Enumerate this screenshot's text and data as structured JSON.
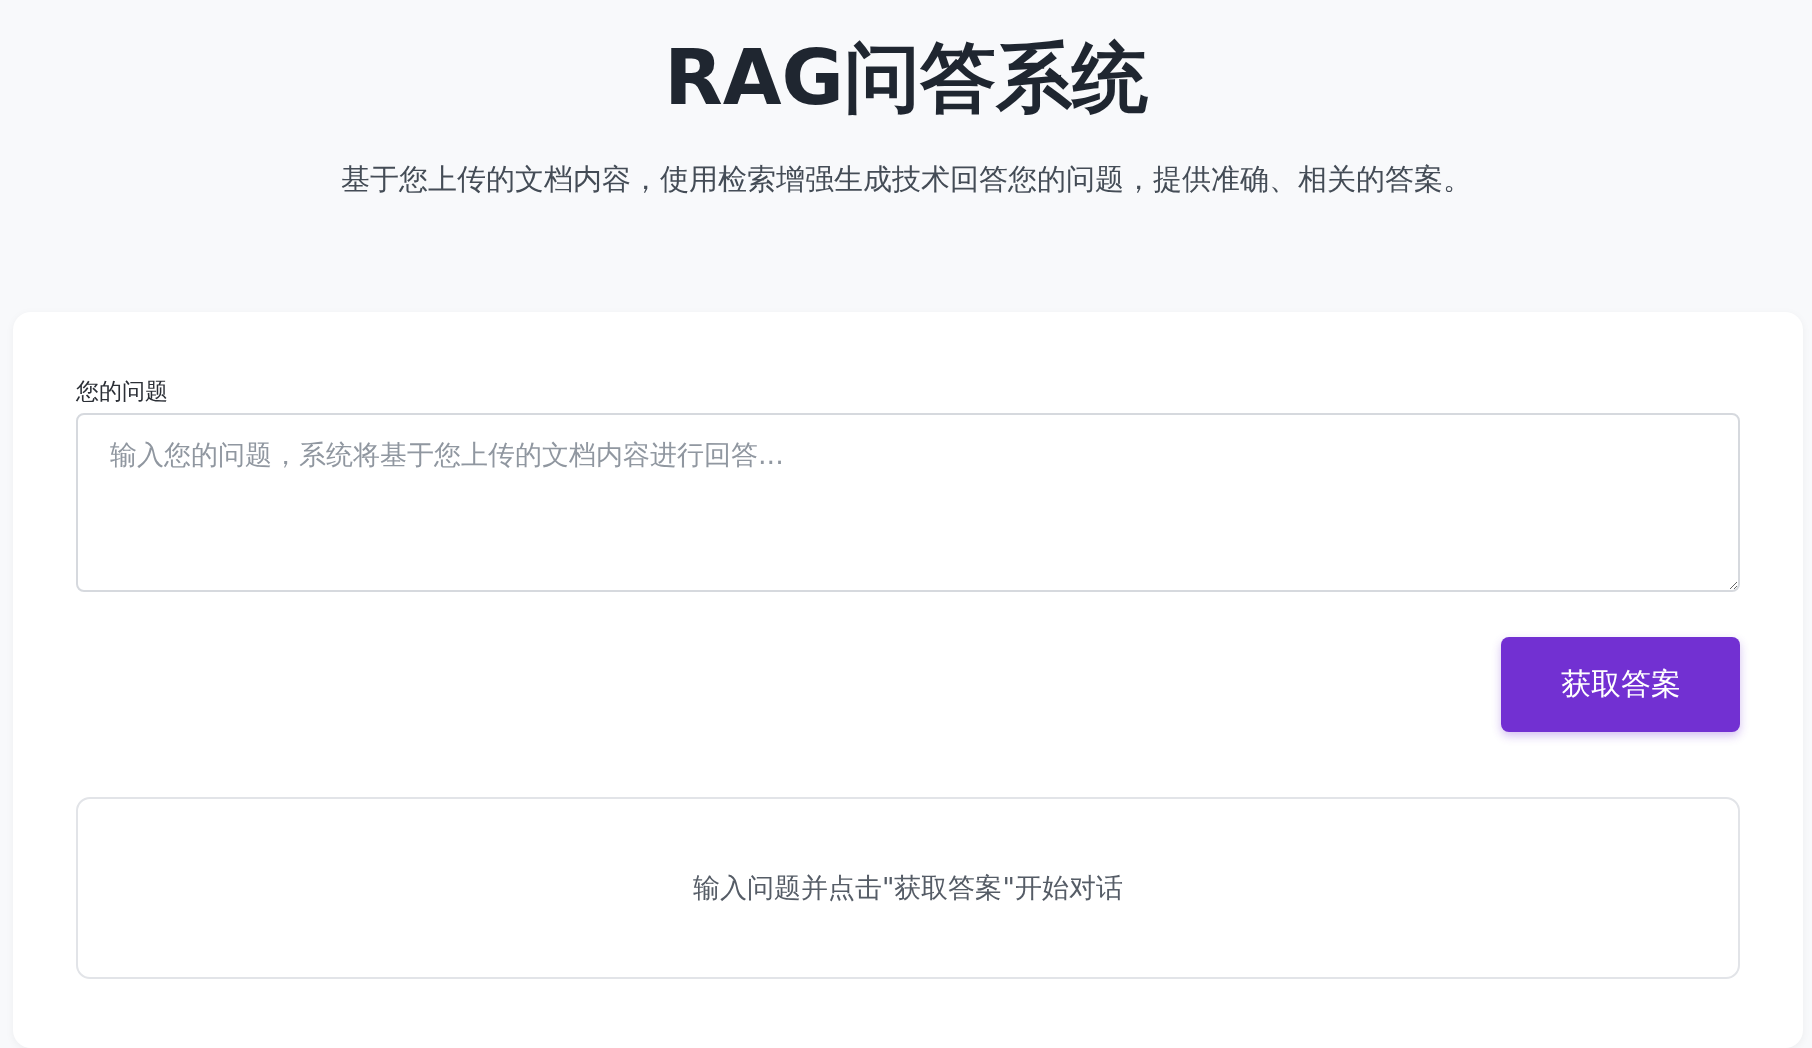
{
  "header": {
    "title": "RAG问答系统",
    "subtitle": "基于您上传的文档内容，使用检索增强生成技术回答您的问题，提供准确、相关的答案。"
  },
  "question": {
    "label": "您的问题",
    "placeholder": "输入您的问题，系统将基于您上传的文档内容进行回答..."
  },
  "submit_button": {
    "label": "获取答案"
  },
  "answer_panel": {
    "message": "输入问题并点击\"获取答案\"开始对话"
  }
}
